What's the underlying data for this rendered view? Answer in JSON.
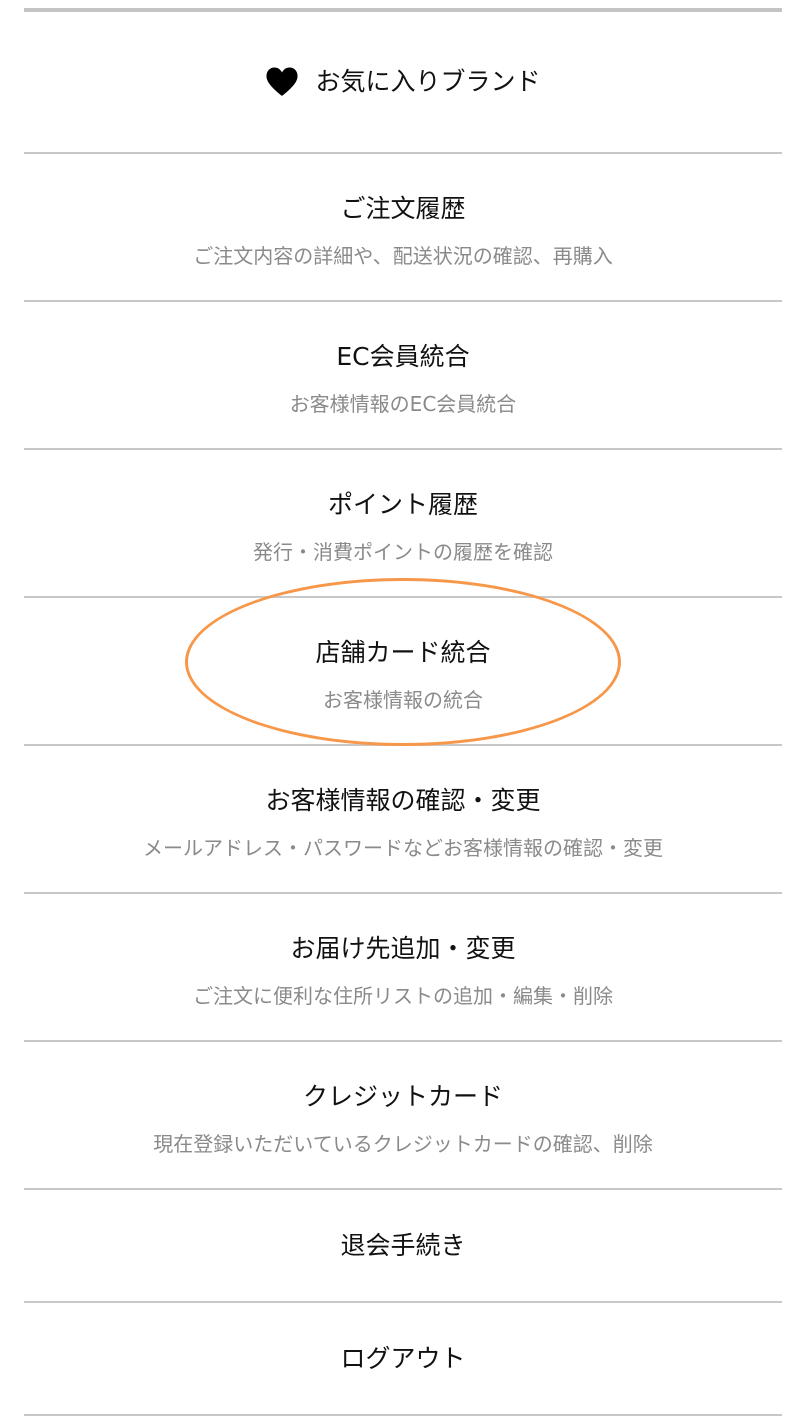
{
  "menu": {
    "favorite_brands": {
      "label": "お気に入りブランド",
      "icon": "heart-icon"
    },
    "items": [
      {
        "title": "ご注文履歴",
        "desc": "ご注文内容の詳細や、配送状況の確認、再購入"
      },
      {
        "title": "EC会員統合",
        "desc": "お客様情報のEC会員統合"
      },
      {
        "title": "ポイント履歴",
        "desc": "発行・消費ポイントの履歴を確認"
      },
      {
        "title": "店舗カード統合",
        "desc": "お客様情報の統合"
      },
      {
        "title": "お客様情報の確認・変更",
        "desc": "メールアドレス・パスワードなどお客様情報の確認・変更"
      },
      {
        "title": "お届け先追加・変更",
        "desc": "ご注文に便利な住所リストの追加・編集・削除"
      },
      {
        "title": "クレジットカード",
        "desc": "現在登録いただいているクレジットカードの確認、削除"
      },
      {
        "title": "退会手続き"
      },
      {
        "title": "ログアウト"
      }
    ]
  },
  "colors": {
    "highlight": "#f6974a",
    "divider": "#c8c8c8",
    "description_text": "#8a8a8a"
  }
}
